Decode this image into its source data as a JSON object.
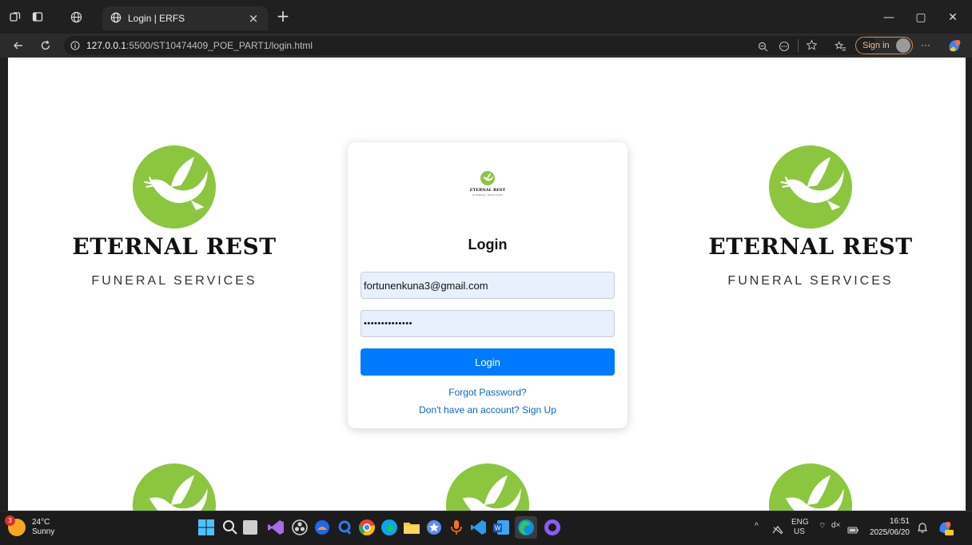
{
  "browser": {
    "tab_title": "Login | ERFS",
    "tab_close": "×",
    "new_tab": "+",
    "url_host": "127.0.0.1",
    "url_rest": ":5500/ST10474409_POE_PART1/login.html",
    "sign_in_label": "Sign in",
    "menu_label": "···",
    "window_minimize": "—",
    "window_restore": "▢",
    "window_close": "✕"
  },
  "brand": {
    "name": "ETERNAL REST",
    "subtitle": "FUNERAL SERVICES",
    "accent_color": "#8cc63f"
  },
  "login": {
    "title": "Login",
    "email_value": "fortunenkuna3@gmail.com",
    "password_value": "••••••••••••••",
    "button_label": "Login",
    "forgot_link": "Forgot Password?",
    "signup_link": "Don't have an account? Sign Up",
    "button_color": "#007bff",
    "logo_name": "ETERNAL REST",
    "logo_sub": "FUNERAL SERVICES"
  },
  "taskbar": {
    "weather_temp": "24°C",
    "weather_desc": "Sunny",
    "weather_badge": "3",
    "language_top": "ENG",
    "language_bottom": "US",
    "time": "16:51",
    "date": "2025/06/20",
    "tray_chevron": "^",
    "tray_net": "⌔",
    "tray_sound": "d×"
  }
}
